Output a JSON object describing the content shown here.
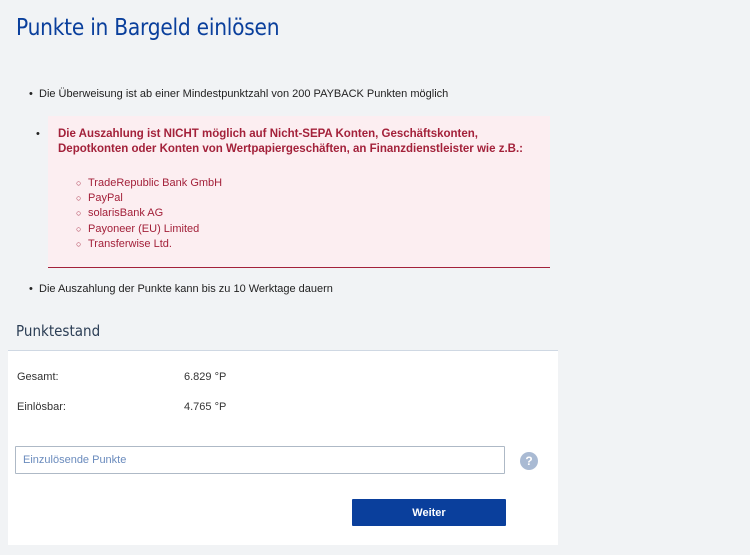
{
  "page": {
    "title": "Punkte in Bargeld einlösen"
  },
  "info": {
    "bullet_symbol": "•",
    "minimum_note": "Die Überweisung ist ab einer Mindestpunktzahl von 200 PAYBACK Punkten möglich",
    "duration_note": "Die Auszahlung der Punkte kann bis zu 10 Werktage dauern"
  },
  "warning": {
    "heading": "Die Auszahlung ist NICHT möglich auf Nicht-SEPA Konten, Geschäftskonten, Depotkonten oder Konten von Wertpapiergeschäften, an Finanzdienstleister wie z.B.:",
    "sub_bullet_symbol": "○",
    "providers": [
      "TradeRepublic Bank GmbH",
      "PayPal",
      "solarisBank AG",
      "Payoneer (EU) Limited",
      "Transferwise Ltd."
    ],
    "text_color": "#a3213a",
    "background_color": "#fceef1"
  },
  "balance": {
    "section_title": "Punktestand",
    "total_label": "Gesamt:",
    "total_value": "6.829 °P",
    "redeemable_label": "Einlösbar:",
    "redeemable_value": "4.765 °P"
  },
  "form": {
    "points_input_placeholder": "Einzulösende Punkte",
    "points_input_value": "",
    "help_icon": "?",
    "submit_label": "Weiter"
  },
  "colors": {
    "brand_blue": "#0a3f9c",
    "page_background": "#f1f3f5"
  }
}
